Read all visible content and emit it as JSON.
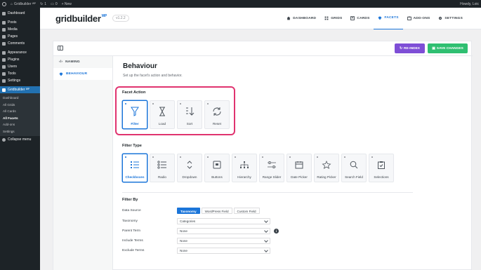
{
  "adminbar": {
    "site": "Gridbuilder ᵂᴾ",
    "updates": "1",
    "comments": "0",
    "new": "+ New",
    "howdy": "Howdy, Loic"
  },
  "wpmenu": {
    "items": [
      {
        "label": "Dashboard"
      },
      {
        "label": "Posts"
      },
      {
        "label": "Media"
      },
      {
        "label": "Pages"
      },
      {
        "label": "Comments"
      },
      {
        "label": "Appearance"
      },
      {
        "label": "Plugins"
      },
      {
        "label": "Users"
      },
      {
        "label": "Tools"
      },
      {
        "label": "Settings"
      },
      {
        "label": "Gridbuilder ᵂᴾ"
      }
    ],
    "sub": [
      "Dashboard",
      "All Grids",
      "All Cards",
      "All Facets",
      "Add-ons",
      "Settings"
    ],
    "collapse": "Collapse menu"
  },
  "header": {
    "logo": "gridbuilder",
    "logo_sup": "WP",
    "version": "v1.2.2",
    "nav": [
      "DASHBOARD",
      "GRIDS",
      "CARDS",
      "FACETS",
      "ADD-ONS",
      "SETTINGS"
    ]
  },
  "toolbar": {
    "reindex": "RE-INDEX",
    "save": "SAVE CHANGES"
  },
  "side_tabs": [
    "NAMING",
    "BEHAVIOUR"
  ],
  "behaviour": {
    "title": "Behaviour",
    "description": "Set up the facet's action and behavior."
  },
  "facet_action": {
    "title": "Facet Action",
    "options": [
      "Filter",
      "Load",
      "Sort",
      "Reset"
    ]
  },
  "filter_type": {
    "title": "Filter Type",
    "options": [
      "Checkboxes",
      "Radio",
      "Dropdown",
      "Buttons",
      "Hierarchy",
      "Range Slider",
      "Date Picker",
      "Rating Picker",
      "Search Field",
      "Selections"
    ]
  },
  "filter_by": {
    "title": "Filter By",
    "data_source_label": "Data Source",
    "data_source_options": [
      "Taxonomy",
      "WordPress Field",
      "Custom Field"
    ],
    "taxonomy_label": "Taxonomy",
    "taxonomy_value": "Categories",
    "parent_term_label": "Parent Term",
    "parent_term_value": "None",
    "include_terms_label": "Include Terms",
    "include_terms_value": "None",
    "exclude_terms_label": "Exclude Terms",
    "exclude_terms_value": "None",
    "info": "i"
  },
  "colors": {
    "accent": "#1b75d9",
    "reindex": "#7e4ed6",
    "save": "#2fbf71",
    "highlight": "#e0336f",
    "wp_dark": "#1d2327"
  }
}
